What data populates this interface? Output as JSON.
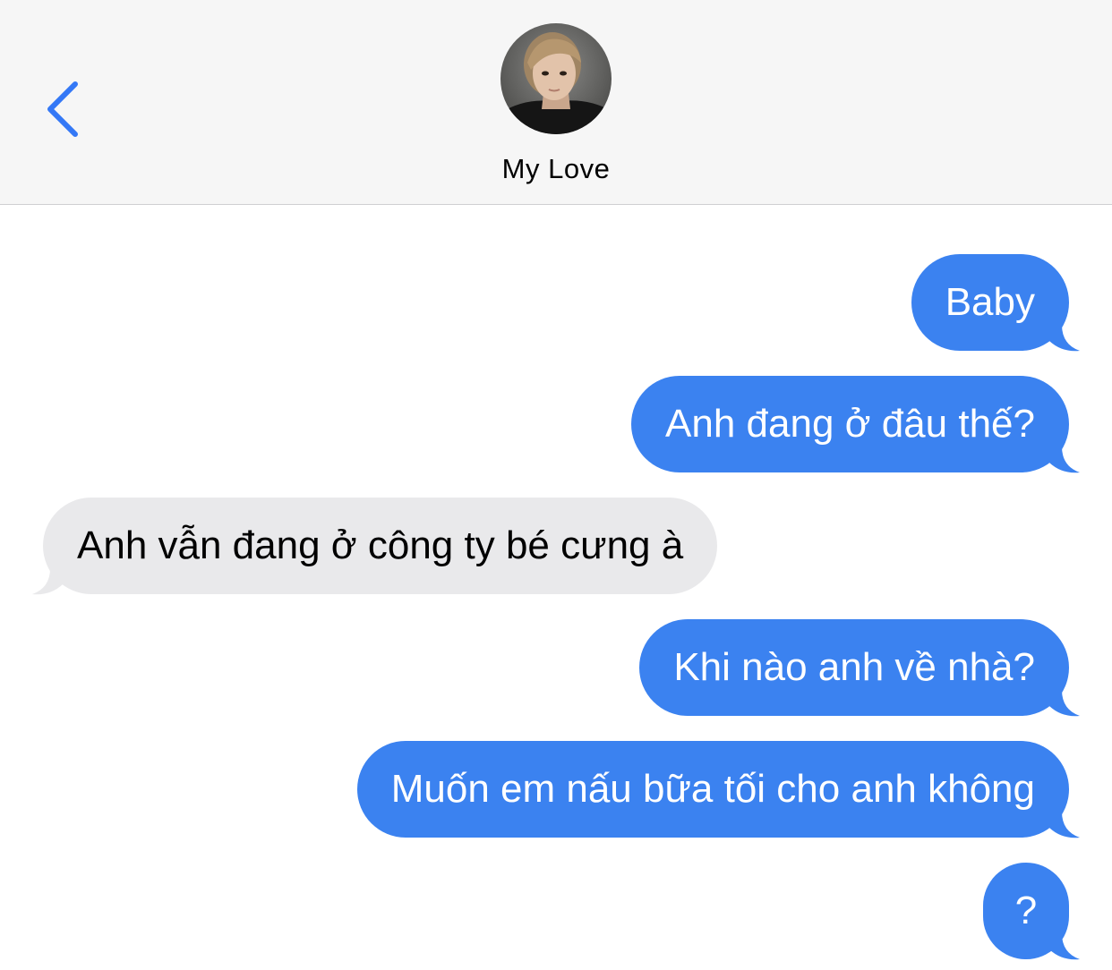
{
  "header": {
    "back_icon": "chevron-left-icon",
    "contact_name": "My Love",
    "avatar_icon": "contact-avatar-photo"
  },
  "colors": {
    "sent_bubble": "#3b82f0",
    "received_bubble": "#e9e9eb",
    "accent": "#3478f6",
    "header_bg": "#f6f6f6"
  },
  "messages": [
    {
      "direction": "sent",
      "text": "Baby"
    },
    {
      "direction": "sent",
      "text": "Anh đang ở đâu thế?"
    },
    {
      "direction": "received",
      "text": "Anh vẫn đang ở công ty bé cưng à"
    },
    {
      "direction": "sent",
      "text": "Khi nào anh về nhà?"
    },
    {
      "direction": "sent",
      "text": "Muốn em nấu bữa tối cho anh không"
    },
    {
      "direction": "sent",
      "text": "?"
    }
  ]
}
